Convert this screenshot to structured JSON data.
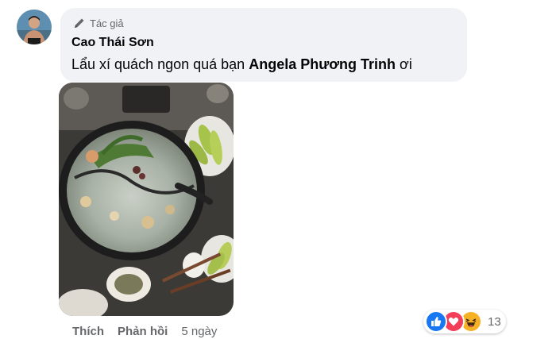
{
  "comment": {
    "author_badge": "Tác giả",
    "author_name": "Cao Thái Sơn",
    "text_before": "Lẩu xí quách ngon quá bạn ",
    "mention": "Angela Phương Trinh",
    "text_after": " ơi"
  },
  "actions": {
    "like_label": "Thích",
    "reply_label": "Phản hồi",
    "timestamp": "5 ngày"
  },
  "reactions": {
    "types": [
      "like-icon",
      "love-icon",
      "haha-icon"
    ],
    "count": "13",
    "colors": {
      "like": "#1877f2",
      "love": "#f33e58",
      "haha": "#f7b125"
    }
  },
  "theme": {
    "bubble_bg": "#f0f2f5",
    "secondary_text": "#65676b",
    "primary_text": "#050505"
  }
}
